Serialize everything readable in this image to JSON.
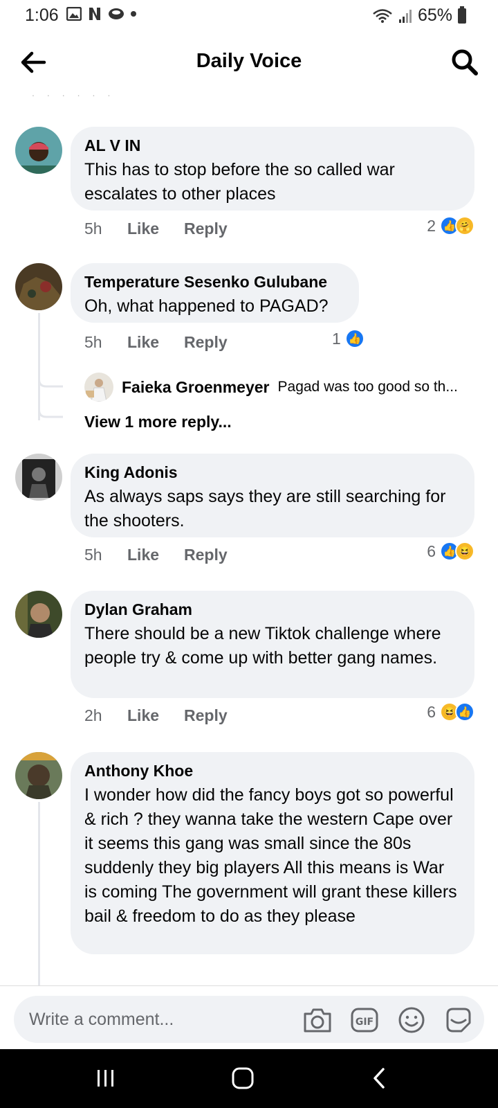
{
  "status_bar": {
    "time": "1:06",
    "battery": "65%"
  },
  "header": {
    "title": "Daily Voice"
  },
  "comments": [
    {
      "name": "AL V IN",
      "text": "This has to stop before the so called war escalates to other places",
      "time": "5h",
      "like": "Like",
      "reply": "Reply",
      "react_count": "2",
      "reactions": [
        "like-icon",
        "care-icon"
      ]
    },
    {
      "name": "Temperature Sesenko Gulubane",
      "text": "Oh, what happened to PAGAD?",
      "time": "5h",
      "like": "Like",
      "reply": "Reply",
      "react_count": "1",
      "reactions": [
        "like-icon"
      ]
    },
    {
      "name": "King Adonis",
      "text": "As always saps says they are still searching for the shooters.",
      "time": "5h",
      "like": "Like",
      "reply": "Reply",
      "react_count": "6",
      "reactions": [
        "like-icon",
        "haha-icon"
      ]
    },
    {
      "name": "Dylan Graham",
      "text": "There should be a new Tiktok challenge where people try & come up with better gang names.",
      "time": "2h",
      "like": "Like",
      "reply": "Reply",
      "react_count": "6",
      "reactions": [
        "haha-icon",
        "like-icon"
      ]
    },
    {
      "name": "Anthony Khoe",
      "text": "I wonder how did the fancy boys got so powerful & rich ? they wanna take the western Cape over it seems this gang was small since the 80s suddenly they big players  All this means is War is coming  The government will grant these killers bail & freedom to do as they please"
    }
  ],
  "reply": {
    "name": "Faieka Groenmeyer",
    "text": "Pagad was too good so th...",
    "view_more": "View 1 more reply..."
  },
  "composer": {
    "placeholder": "Write a comment..."
  },
  "colors": {
    "like": "#1877f2",
    "bubble": "#f0f2f5",
    "meta": "#65676b"
  }
}
